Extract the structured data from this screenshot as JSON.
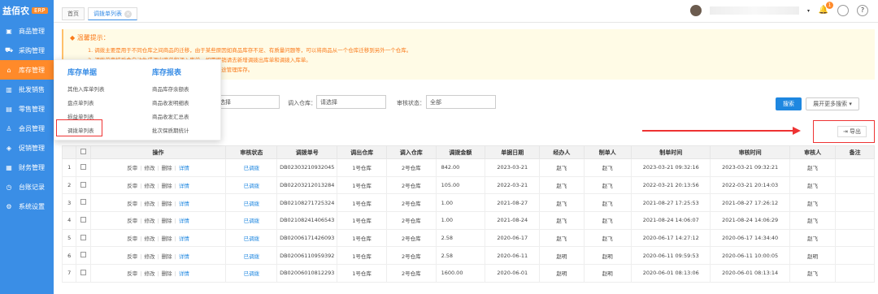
{
  "brand": {
    "name": "益佰农",
    "badge": "ERP"
  },
  "sidebar": {
    "items": [
      {
        "label": "商品管理",
        "icon": "lock-icon"
      },
      {
        "label": "采购管理",
        "icon": "cart-icon"
      },
      {
        "label": "库存管理",
        "icon": "warehouse-icon"
      },
      {
        "label": "批发销售",
        "icon": "chart-icon"
      },
      {
        "label": "零售管理",
        "icon": "store-icon"
      },
      {
        "label": "会员管理",
        "icon": "user-icon"
      },
      {
        "label": "促销管理",
        "icon": "tag-icon"
      },
      {
        "label": "财务管理",
        "icon": "wallet-icon"
      },
      {
        "label": "台账记录",
        "icon": "ledger-icon"
      },
      {
        "label": "系统设置",
        "icon": "gear-icon"
      }
    ]
  },
  "tabs": [
    {
      "label": "首页"
    },
    {
      "label": "调拨单列表"
    }
  ],
  "header": {
    "notification_count": "1"
  },
  "tips": {
    "title": "温馨提示：",
    "lines": [
      "1. 调拨主要是用于不同仓库之间商品的迁移，由于某些原因如商品库存不足、有质量问题等，可以将商品从一个仓库迁移到另外一个仓库。",
      "2. 调拨单审核后会自动生成调出库单和调入库单，如需撤销请去新增调拨出库单和调拨入库单。",
      "3. 调拨单审核后会立即更新相关仓库的商品库存，没有在途管理库存。"
    ]
  },
  "dropdown": {
    "col1": {
      "title": "库存单据",
      "items": [
        "其他入库单列表",
        "盘点单列表",
        "损益单列表",
        "调拨单列表"
      ]
    },
    "col2": {
      "title": "库存报表",
      "items": [
        "商品库存余额表",
        "商品收发明细表",
        "商品收发汇总表",
        "批次保质期统计"
      ]
    }
  },
  "filter": {
    "in_label": "调入仓库：",
    "in_value": "请选择",
    "out_value": "请选择",
    "status_label": "审核状态：",
    "status_value": "全部",
    "search": "搜索",
    "more": "展开更多搜索 ▾"
  },
  "export": "导出",
  "table": {
    "headers": [
      "",
      "",
      "操作",
      "审核状态",
      "调拨单号",
      "调出仓库",
      "调入仓库",
      "调拨金额",
      "单据日期",
      "经办人",
      "制单人",
      "制单时间",
      "审核时间",
      "审核人",
      "备注"
    ],
    "ops": {
      "reject": "反审",
      "edit": "修改",
      "del": "删除",
      "detail": "详情"
    },
    "rows": [
      {
        "no": "1",
        "status": "已调拨",
        "code": "DB02303210932045",
        "from": "1号仓库",
        "to": "2号仓库",
        "amount": "842.00",
        "date": "2023-03-21",
        "handler": "赵飞",
        "maker": "赵飞",
        "make_time": "2023-03-21 09:32:16",
        "audit_time": "2023-03-21 09:32:21",
        "auditor": "赵飞",
        "note": ""
      },
      {
        "no": "2",
        "status": "已调拨",
        "code": "DB02203212013284",
        "from": "1号仓库",
        "to": "2号仓库",
        "amount": "105.00",
        "date": "2022-03-21",
        "handler": "赵飞",
        "maker": "赵飞",
        "make_time": "2022-03-21 20:13:56",
        "audit_time": "2022-03-21 20:14:03",
        "auditor": "赵飞",
        "note": ""
      },
      {
        "no": "3",
        "status": "已调拨",
        "code": "DB02108271725324",
        "from": "1号仓库",
        "to": "2号仓库",
        "amount": "1.00",
        "date": "2021-08-27",
        "handler": "赵飞",
        "maker": "赵飞",
        "make_time": "2021-08-27 17:25:53",
        "audit_time": "2021-08-27 17:26:12",
        "auditor": "赵飞",
        "note": ""
      },
      {
        "no": "4",
        "status": "已调拨",
        "code": "DB02108241406543",
        "from": "1号仓库",
        "to": "2号仓库",
        "amount": "1.00",
        "date": "2021-08-24",
        "handler": "赵飞",
        "maker": "赵飞",
        "make_time": "2021-08-24 14:06:07",
        "audit_time": "2021-08-24 14:06:29",
        "auditor": "赵飞",
        "note": ""
      },
      {
        "no": "5",
        "status": "已调拨",
        "code": "DB02006171426093",
        "from": "1号仓库",
        "to": "2号仓库",
        "amount": "2.58",
        "date": "2020-06-17",
        "handler": "赵飞",
        "maker": "赵飞",
        "make_time": "2020-06-17 14:27:12",
        "audit_time": "2020-06-17 14:34:40",
        "auditor": "赵飞",
        "note": ""
      },
      {
        "no": "6",
        "status": "已调拨",
        "code": "DB02006110959392",
        "from": "1号仓库",
        "to": "2号仓库",
        "amount": "2.58",
        "date": "2020-06-11",
        "handler": "赵明",
        "maker": "赵明",
        "make_time": "2020-06-11 09:59:53",
        "audit_time": "2020-06-11 10:00:05",
        "auditor": "赵明",
        "note": ""
      },
      {
        "no": "7",
        "status": "已调拨",
        "code": "DB02006010812293",
        "from": "1号仓库",
        "to": "2号仓库",
        "amount": "1600.00",
        "date": "2020-06-01",
        "handler": "赵明",
        "maker": "赵明",
        "make_time": "2020-06-01 08:13:06",
        "audit_time": "2020-06-01 08:13:14",
        "auditor": "赵飞",
        "note": ""
      }
    ]
  }
}
